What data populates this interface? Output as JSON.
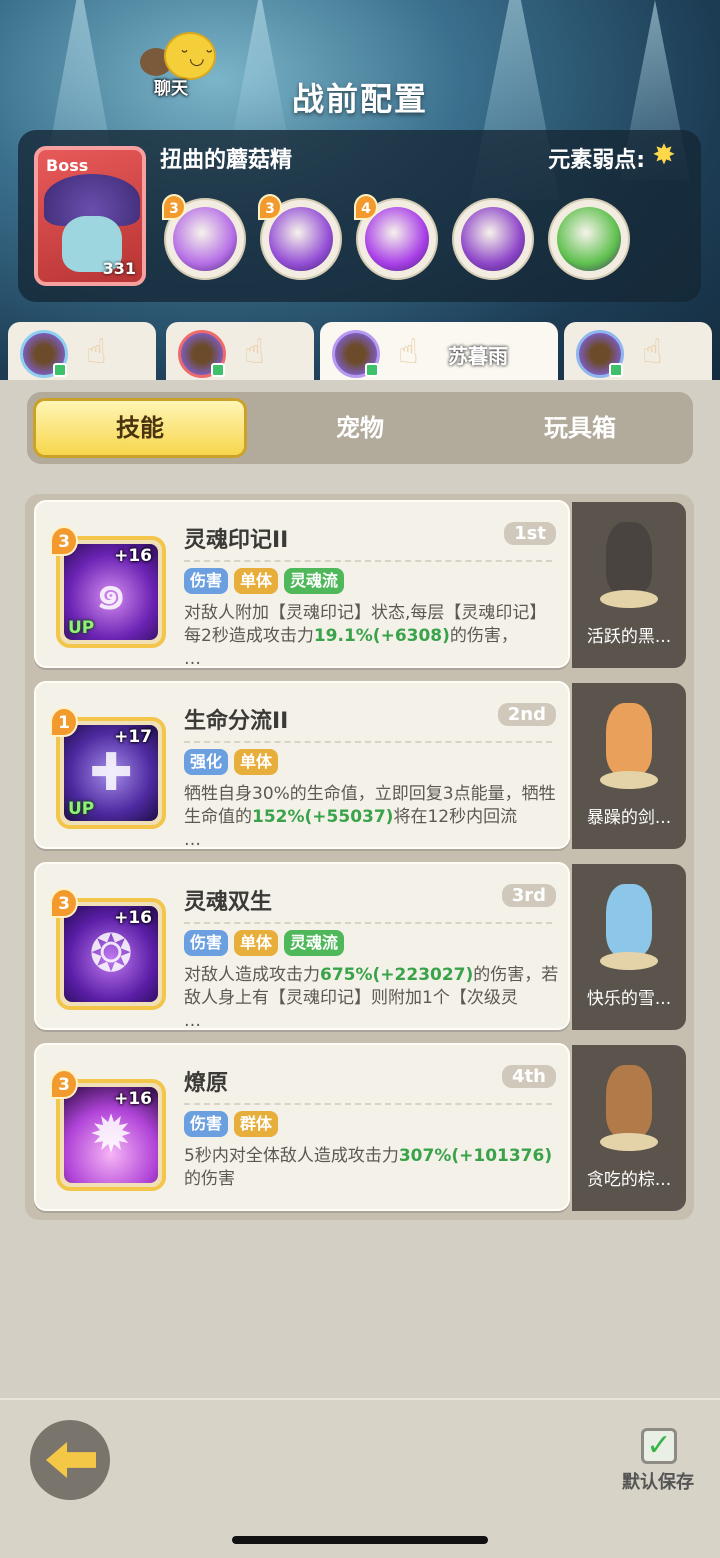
{
  "header": {
    "chat_label": "聊天",
    "title": "战前配置"
  },
  "boss": {
    "tag": "Boss",
    "level": "331",
    "name": "扭曲的蘑菇精",
    "weakness_label": "元素弱点:",
    "weakness_icon": "light-element-icon",
    "skills": [
      {
        "level": "3",
        "color": "#b66fe6",
        "icon": "spiral-soul-icon"
      },
      {
        "level": "3",
        "color": "#9550d6",
        "icon": "water-drop-icon"
      },
      {
        "level": "4",
        "color": "#a940e8",
        "icon": "mushroom-burst-icon"
      },
      {
        "level": "",
        "color": "#8f47c9",
        "icon": "mushroom-icon"
      },
      {
        "level": "",
        "color": "#5fc04e",
        "icon": "slime-icon"
      }
    ]
  },
  "heroes": [
    {
      "name": "",
      "element_icon": "water-element-icon"
    },
    {
      "name": "",
      "element_icon": "fire-element-icon"
    },
    {
      "name": "苏暮雨",
      "element_icon": "dark-element-icon"
    },
    {
      "name": "",
      "element_icon": "wind-element-icon"
    }
  ],
  "tabs": [
    "技能",
    "宠物",
    "玩具箱"
  ],
  "skills": [
    {
      "name": "灵魂印记II",
      "rank": "1st",
      "level": "3",
      "plus": "+16",
      "up": "UP",
      "tags": [
        {
          "text": "伤害",
          "kind": "blue"
        },
        {
          "text": "单体",
          "kind": "orange"
        },
        {
          "text": "灵魂流",
          "kind": "green"
        }
      ],
      "desc_parts": [
        "对敌人附加【灵魂印记】状态,每层【灵魂印记】每2秒造成攻击力",
        "19.1%(+6308)",
        "的伤害，",
        "…"
      ],
      "pet_name": "活跃的黑..."
    },
    {
      "name": "生命分流II",
      "rank": "2nd",
      "level": "1",
      "plus": "+17",
      "up": "UP",
      "tags": [
        {
          "text": "强化",
          "kind": "blue"
        },
        {
          "text": "单体",
          "kind": "orange"
        }
      ],
      "desc_parts": [
        "牺牲自身30%的生命值，立即回复3点能量，牺牲生命值的",
        "152%(+55037)",
        "将在12秒内回流",
        "…"
      ],
      "pet_name": "暴躁的剑..."
    },
    {
      "name": "灵魂双生",
      "rank": "3rd",
      "level": "3",
      "plus": "+16",
      "up": "",
      "tags": [
        {
          "text": "伤害",
          "kind": "blue"
        },
        {
          "text": "单体",
          "kind": "orange"
        },
        {
          "text": "灵魂流",
          "kind": "green"
        }
      ],
      "desc_parts": [
        "对敌人造成攻击力",
        "675%(+223027)",
        "的伤害，若敌人身上有【灵魂印记】则附加1个【次级灵",
        "…"
      ],
      "pet_name": "快乐的雪..."
    },
    {
      "name": "燎原",
      "rank": "4th",
      "level": "3",
      "plus": "+16",
      "up": "",
      "tags": [
        {
          "text": "伤害",
          "kind": "blue"
        },
        {
          "text": "群体",
          "kind": "orange"
        }
      ],
      "desc_parts": [
        "5秒内对全体敌人造成攻击力",
        "307%(+101376)",
        "的伤害",
        ""
      ],
      "pet_name": "贪吃的棕..."
    }
  ],
  "footer": {
    "save_label": "默认保存"
  }
}
